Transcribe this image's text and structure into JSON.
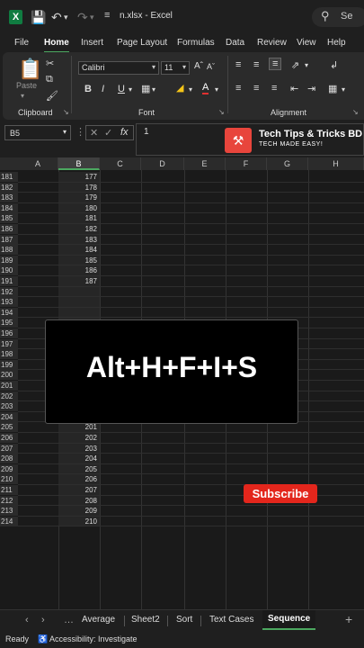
{
  "titlebar": {
    "file_name": "n.xlsx",
    "app_name": "Excel",
    "search_label": "Se"
  },
  "menu": [
    "File",
    "Home",
    "Insert",
    "Page Layout",
    "Formulas",
    "Data",
    "Review",
    "View",
    "Help"
  ],
  "ribbon": {
    "paste_label": "Paste",
    "font_name": "Calibri",
    "font_size": "11",
    "group_clipboard": "Clipboard",
    "group_font": "Font",
    "group_alignment": "Alignment",
    "bold": "B",
    "italic": "I",
    "underline": "U"
  },
  "formula": {
    "name_box": "B5",
    "fx": "fx",
    "value": "1"
  },
  "brand": {
    "name": "Tech Tips & Tricks BD",
    "tagline": "TECH MADE EASY!"
  },
  "columns": [
    "A",
    "B",
    "C",
    "D",
    "E",
    "F",
    "G",
    "H"
  ],
  "selected_column": "B",
  "rows": [
    {
      "num": "181",
      "b": "177"
    },
    {
      "num": "182",
      "b": "178"
    },
    {
      "num": "183",
      "b": "179"
    },
    {
      "num": "184",
      "b": "180"
    },
    {
      "num": "185",
      "b": "181"
    },
    {
      "num": "186",
      "b": "182"
    },
    {
      "num": "187",
      "b": "183"
    },
    {
      "num": "188",
      "b": "184"
    },
    {
      "num": "189",
      "b": "185"
    },
    {
      "num": "190",
      "b": "186"
    },
    {
      "num": "191",
      "b": "187"
    },
    {
      "num": "192",
      "b": ""
    },
    {
      "num": "193",
      "b": ""
    },
    {
      "num": "194",
      "b": ""
    },
    {
      "num": "195",
      "b": ""
    },
    {
      "num": "196",
      "b": ""
    },
    {
      "num": "197",
      "b": ""
    },
    {
      "num": "198",
      "b": ""
    },
    {
      "num": "199",
      "b": ""
    },
    {
      "num": "200",
      "b": "196"
    },
    {
      "num": "201",
      "b": "197"
    },
    {
      "num": "202",
      "b": "198"
    },
    {
      "num": "203",
      "b": "199"
    },
    {
      "num": "204",
      "b": "200"
    },
    {
      "num": "205",
      "b": "201"
    },
    {
      "num": "206",
      "b": "202"
    },
    {
      "num": "207",
      "b": "203"
    },
    {
      "num": "208",
      "b": "204"
    },
    {
      "num": "209",
      "b": "205"
    },
    {
      "num": "210",
      "b": "206"
    },
    {
      "num": "211",
      "b": "207"
    },
    {
      "num": "212",
      "b": "208"
    },
    {
      "num": "213",
      "b": "209"
    },
    {
      "num": "214",
      "b": "210"
    }
  ],
  "overlay_text": "Alt+H+F+I+S",
  "subscribe_label": "Subscribe",
  "sheet_tabs": [
    "Average",
    "Sheet2",
    "Sort",
    "Text Cases",
    "Sequence"
  ],
  "active_sheet": "Sequence",
  "status": {
    "ready": "Ready",
    "accessibility": "Accessibility: Investigate"
  },
  "colors": {
    "excel_green": "#107c41",
    "accent_green": "#4ca860",
    "subscribe_red": "#e3261c",
    "brand_red": "#e8453c"
  }
}
